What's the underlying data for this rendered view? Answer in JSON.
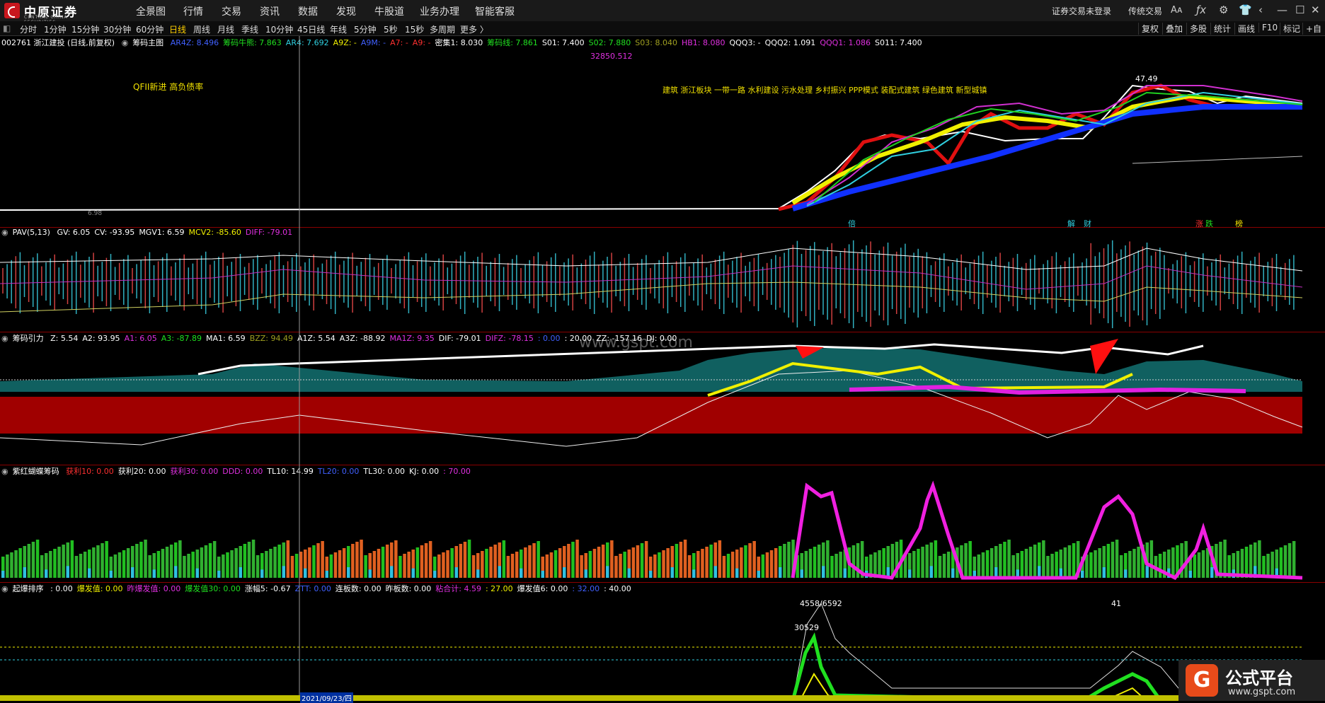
{
  "app": {
    "logo_text": "中原证券",
    "logo_sub": "CENTRAL CHINA SECURITIES"
  },
  "menu": [
    "全景图",
    "行情",
    "交易",
    "资讯",
    "数据",
    "发现",
    "牛股道",
    "业务办理",
    "智能客服"
  ],
  "top_right": {
    "login": "证券交易未登录",
    "mode": "传统交易",
    "font": "Aᴀ",
    "icons": [
      "font-size-icon",
      "formula-icon",
      "gear-icon",
      "shirt-icon",
      "back-icon",
      "minimize-icon",
      "maximize-icon",
      "close-icon"
    ]
  },
  "periods": [
    "分时",
    "1分钟",
    "15分钟",
    "30分钟",
    "60分钟",
    "日线",
    "周线",
    "月线",
    "季线",
    "10分钟",
    "45日线",
    "年线",
    "5分钟",
    "5秒",
    "15秒",
    "多周期",
    "更多 〉"
  ],
  "active_period": "日线",
  "right_tools": [
    "复权",
    "叠加",
    "多股",
    "统计",
    "画线",
    "F10",
    "标记",
    "+自"
  ],
  "main_panel": {
    "stock": "002761 浙江建投 (日线,前复权)",
    "indicator": "筹码主图",
    "values": [
      {
        "t": "AR4Z: 8.496",
        "c": "blue"
      },
      {
        "t": "筹码牛熊: 7.863",
        "c": "green"
      },
      {
        "t": "AR4: 7.692",
        "c": "cyan"
      },
      {
        "t": "A9Z: -",
        "c": "yellow"
      },
      {
        "t": "A9M: -",
        "c": "blue"
      },
      {
        "t": "A7: -",
        "c": "red"
      },
      {
        "t": "A9: -",
        "c": "red"
      },
      {
        "t": "密集1: 8.030",
        "c": "white"
      },
      {
        "t": "筹码线: 7.861",
        "c": "green"
      },
      {
        "t": "S01: 7.400",
        "c": "white"
      },
      {
        "t": "S02: 7.880",
        "c": "green"
      },
      {
        "t": "S03: 8.040",
        "c": "olive"
      },
      {
        "t": "HB1: 8.080",
        "c": "mag"
      },
      {
        "t": "QQQ3: -",
        "c": "white"
      },
      {
        "t": "QQQ2: 1.091",
        "c": "white"
      },
      {
        "t": "QQQ1: 1.086",
        "c": "mag"
      },
      {
        "t": "S011: 7.400",
        "c": "white"
      }
    ],
    "volume_label": "32850.512",
    "notice": "QFII新进  高负债率",
    "concepts": "建筑  浙江板块  一带一路  水利建设  污水处理  乡村振兴  PPP模式  装配式建筑  绿色建筑  新型城镇",
    "high_price": "47.49",
    "price_low_note": "6.98",
    "events": [
      "倍",
      "解",
      "财",
      "涨",
      "跌",
      "榜"
    ]
  },
  "pav_panel": {
    "indicator": "PAV(5,13)",
    "values": [
      {
        "t": "GV: 6.05",
        "c": "white"
      },
      {
        "t": "CV: -93.95",
        "c": "white"
      },
      {
        "t": "MGV1: 6.59",
        "c": "white"
      },
      {
        "t": "MCV2: -85.60",
        "c": "yellow"
      },
      {
        "t": "DIFF: -79.01",
        "c": "mag"
      }
    ]
  },
  "chip_panel": {
    "indicator": "筹码引力",
    "values": [
      {
        "t": "Z: 5.54",
        "c": "white"
      },
      {
        "t": "A2: 93.95",
        "c": "white"
      },
      {
        "t": "A1: 6.05",
        "c": "mag"
      },
      {
        "t": "A3: -87.89",
        "c": "green"
      },
      {
        "t": "MA1: 6.59",
        "c": "white"
      },
      {
        "t": "BZZ: 94.49",
        "c": "olive"
      },
      {
        "t": "A1Z: 5.54",
        "c": "white"
      },
      {
        "t": "A3Z: -88.92",
        "c": "white"
      },
      {
        "t": "MA1Z: 9.35",
        "c": "mag"
      },
      {
        "t": "DIF: -79.01",
        "c": "white"
      },
      {
        "t": "DIFZ: -78.15",
        "c": "mag"
      },
      {
        "t": ": 0.00",
        "c": "blue"
      },
      {
        "t": ": 20.00",
        "c": "white"
      },
      {
        "t": "ZZ: -157.16",
        "c": "white"
      },
      {
        "t": "DJ: 0.00",
        "c": "white"
      }
    ]
  },
  "red_panel": {
    "indicator": "紫红蝴蝶筹码",
    "values": [
      {
        "t": "获利10: 0.00",
        "c": "red"
      },
      {
        "t": "获利20: 0.00",
        "c": "white"
      },
      {
        "t": "获利30: 0.00",
        "c": "mag"
      },
      {
        "t": "DDD: 0.00",
        "c": "mag"
      },
      {
        "t": "TL10: 14.99",
        "c": "white"
      },
      {
        "t": "TL20: 0.00",
        "c": "blue"
      },
      {
        "t": "TL30: 0.00",
        "c": "white"
      },
      {
        "t": "KJ: 0.00",
        "c": "white"
      },
      {
        "t": ": 70.00",
        "c": "mag"
      }
    ]
  },
  "burst_panel": {
    "indicator": "起爆排序",
    "values": [
      {
        "t": ": 0.00",
        "c": "white"
      },
      {
        "t": "爆发值: 0.00",
        "c": "yellow"
      },
      {
        "t": "昨爆发值: 0.00",
        "c": "mag"
      },
      {
        "t": "爆发值30: 0.00",
        "c": "green"
      },
      {
        "t": "涨幅5: -0.67",
        "c": "white"
      },
      {
        "t": "ZTT: 0.00",
        "c": "blue"
      },
      {
        "t": "连板数: 0.00",
        "c": "white"
      },
      {
        "t": "昨板数: 0.00",
        "c": "white"
      },
      {
        "t": "粘合计: 4.59",
        "c": "mag"
      },
      {
        "t": ": 27.00",
        "c": "yellow"
      },
      {
        "t": "爆发值6: 0.00",
        "c": "white"
      },
      {
        "t": ": 32.00",
        "c": "blue"
      },
      {
        "t": ": 40.00",
        "c": "white"
      }
    ],
    "peak_labels": [
      "4558/6592",
      "30529",
      "41"
    ],
    "date": "2021/09/23/四"
  },
  "watermark": {
    "site": "www.gspt.com",
    "title": "公式平台",
    "url": "www.gspt.com",
    "icon": "G"
  }
}
